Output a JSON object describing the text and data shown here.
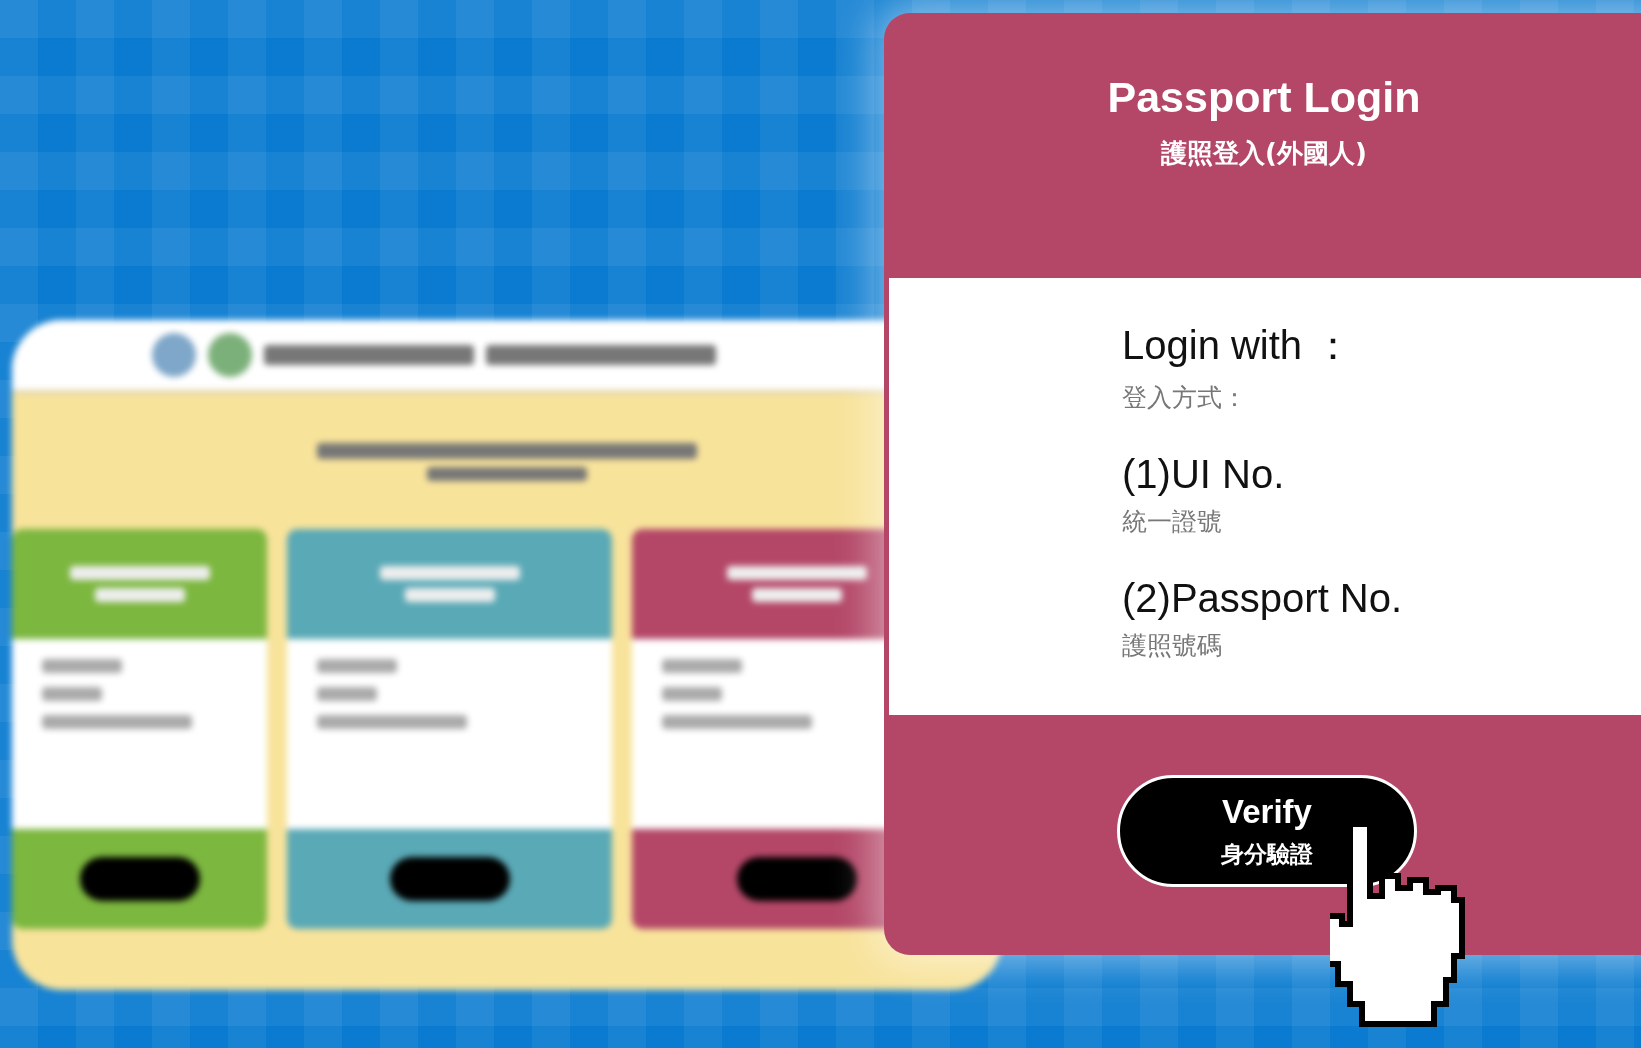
{
  "background_page": {
    "columns": [
      {
        "color": "#7cb73f"
      },
      {
        "color": "#5aa9b6"
      },
      {
        "color": "#b44768"
      }
    ]
  },
  "login_card": {
    "title": "Passport Login",
    "subtitle": "護照登入(外國人)",
    "login_with": {
      "label": "Login with ：",
      "sub": "登入方式："
    },
    "methods": [
      {
        "label": "(1)UI No.",
        "sub": "統一證號"
      },
      {
        "label": "(2)Passport No.",
        "sub": "護照號碼"
      }
    ],
    "button": {
      "label": "Verify",
      "sub": "身分驗證"
    }
  }
}
